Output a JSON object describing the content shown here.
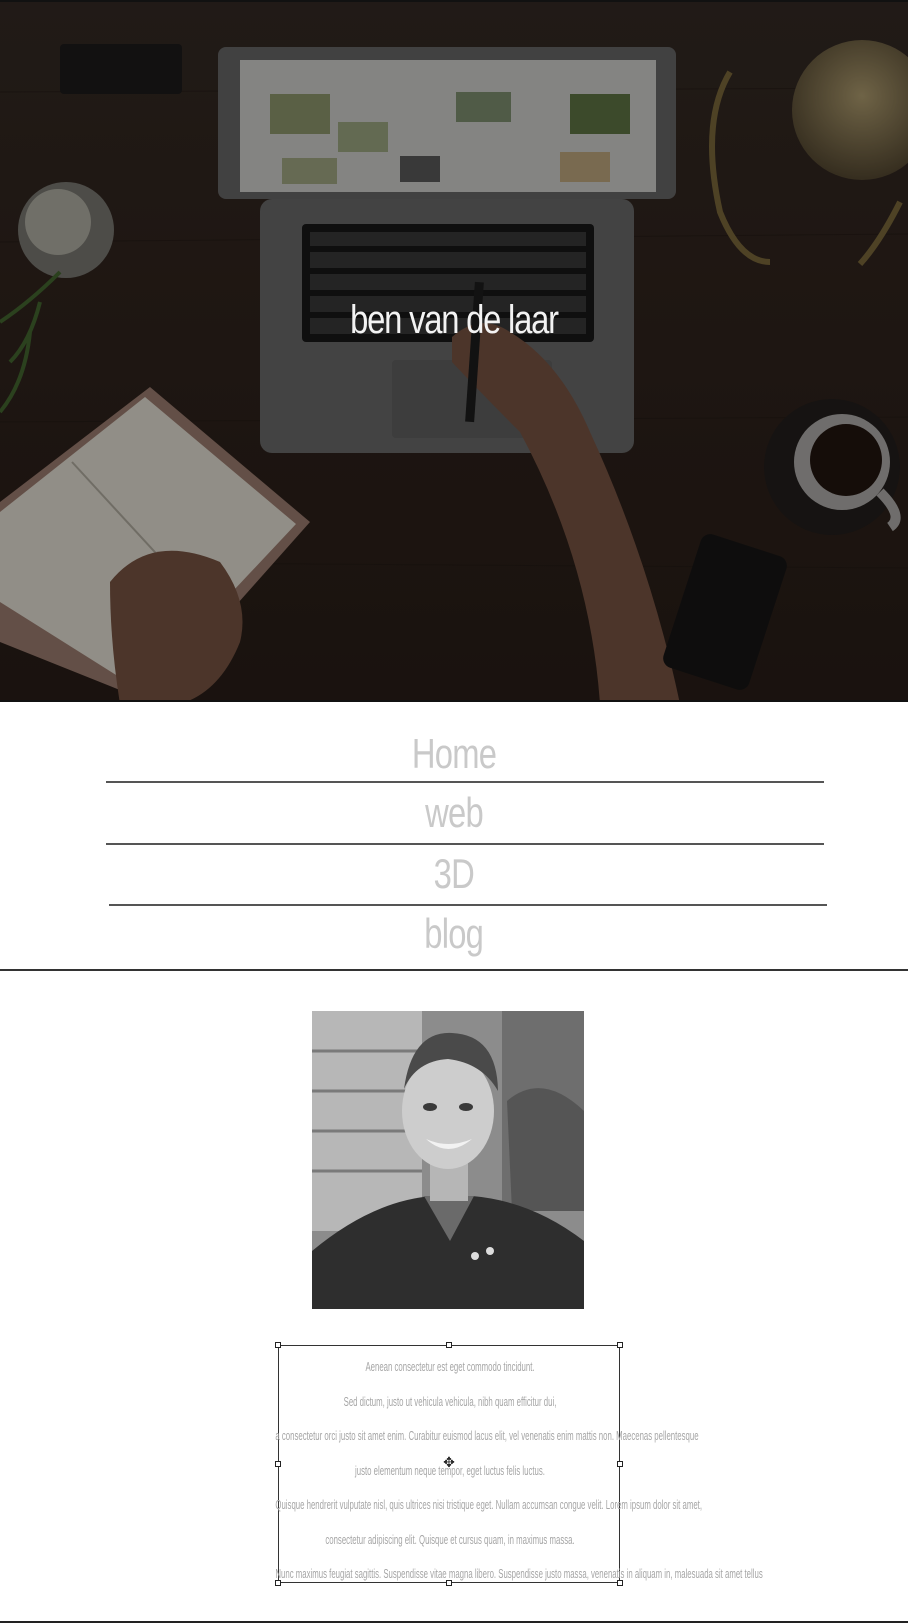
{
  "hero": {
    "title": "ben van de laar"
  },
  "nav": {
    "items": [
      {
        "label": "Home"
      },
      {
        "label": "web"
      },
      {
        "label": "3D"
      },
      {
        "label": "blog"
      }
    ]
  },
  "about": {
    "lines": [
      "Aenean consectetur est eget commodo tincidunt.",
      "Sed dictum, justo ut vehicula vehicula, nibh quam efficitur dui,",
      "a consectetur orci justo sit amet enim. Curabitur euismod lacus elit, vel venenatis enim mattis non. Maecenas pellentesque",
      "justo elementum neque tempor, eget luctus felis luctus.",
      "Quisque hendrerit vulputate nisl, quis ultrices nisi tristique eget. Nullam accumsan congue velit. Lorem ipsum dolor sit amet,",
      "consectetur adipiscing elit. Quisque et cursus quam, in maximus massa.",
      "Nunc maximus feugiat sagittis. Suspendisse vitae magna libero. Suspendisse justo massa, venenatis in aliquam in, malesuada sit amet tellus"
    ]
  },
  "colors": {
    "nav_text": "#c9c9c9",
    "hero_title": "#f3f3f3",
    "body_text": "#a6a6a6"
  }
}
